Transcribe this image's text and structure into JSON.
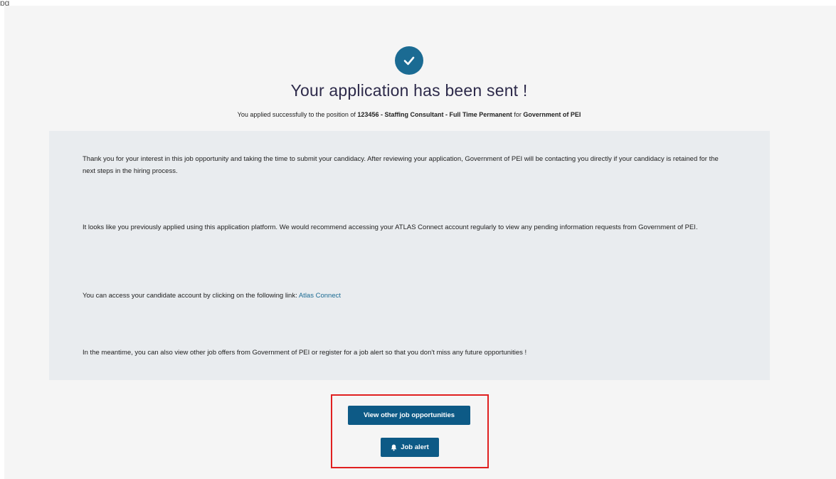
{
  "page_edge_text": "pg",
  "success": {
    "title": "Your application has been sent !",
    "subtitle": {
      "prefix": "You applied successfully to the position of ",
      "position": "123456 - Staffing Consultant - Full Time Permanent",
      "middle": " for ",
      "organization": "Government of PEI"
    }
  },
  "messages": {
    "thanks": "Thank you for your interest in this job opportunity and taking the time to submit your candidacy. After reviewing your application, Government of PEI will be contacting you directly if your candidacy is retained for the next steps in the hiring process.",
    "previous": "It looks like you previously applied using this application platform. We would recommend accessing your ATLAS Connect account regularly to view any pending information requests from Government of PEI.",
    "access_prefix": "You can access your candidate account by clicking on the following link: ",
    "access_link": "Atlas Connect",
    "meantime": "In the meantime, you can also view other job offers from Government of PEI or register for a job alert so that you don't miss any future opportunities !"
  },
  "actions": {
    "view_jobs_label": "View other job opportunities",
    "job_alert_label": "Job alert"
  },
  "colors": {
    "accent": "#0d5a86",
    "check_badge": "#1b6b93",
    "panel": "#e9ecef",
    "highlight": "#e02020"
  },
  "icons": {
    "success": "check-circle-icon",
    "alert": "bell-icon"
  }
}
